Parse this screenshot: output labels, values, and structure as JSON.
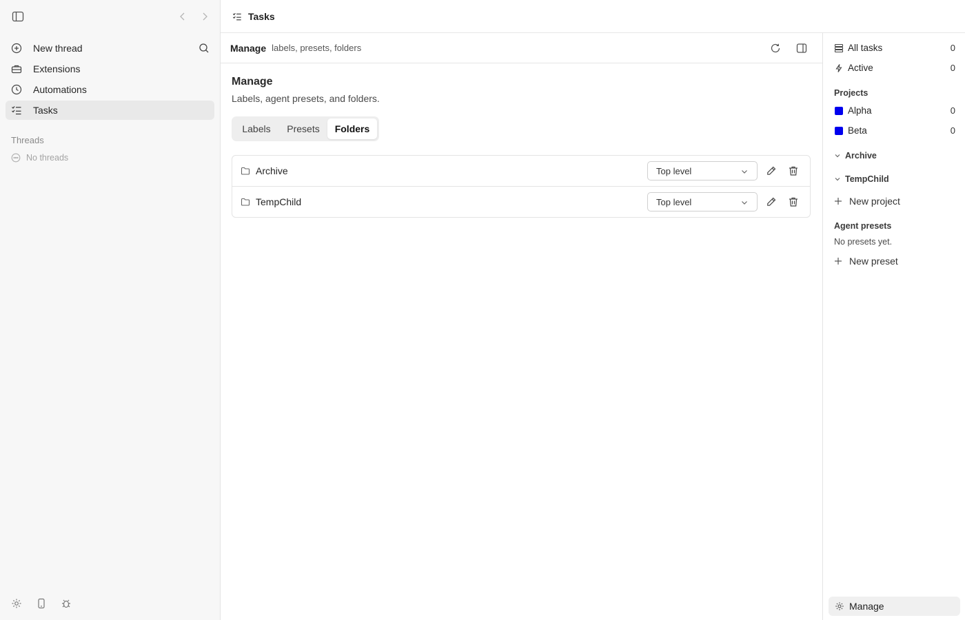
{
  "sidebar": {
    "nav": [
      {
        "label": "New thread",
        "icon": "plus-circle-icon"
      },
      {
        "label": "Extensions",
        "icon": "toolbox-icon"
      },
      {
        "label": "Automations",
        "icon": "clock-icon"
      },
      {
        "label": "Tasks",
        "icon": "checklist-icon",
        "active": true
      }
    ],
    "threads_heading": "Threads",
    "threads_empty": "No threads"
  },
  "header": {
    "title": "Tasks"
  },
  "main": {
    "subheader": {
      "title": "Manage",
      "subtitle": "labels, presets, folders"
    },
    "title": "Manage",
    "subtitle": "Labels, agent presets, and folders.",
    "tabs": [
      {
        "label": "Labels"
      },
      {
        "label": "Presets"
      },
      {
        "label": "Folders",
        "selected": true
      }
    ],
    "folders": [
      {
        "name": "Archive",
        "parent": "Top level"
      },
      {
        "name": "TempChild",
        "parent": "Top level"
      }
    ]
  },
  "rpanel": {
    "all_tasks": {
      "label": "All tasks",
      "count": "0"
    },
    "active": {
      "label": "Active",
      "count": "0"
    },
    "projects_heading": "Projects",
    "projects": [
      {
        "label": "Alpha",
        "count": "0",
        "color": "#0000ee"
      },
      {
        "label": "Beta",
        "count": "0",
        "color": "#0000ee"
      }
    ],
    "folders": [
      {
        "label": "Archive"
      },
      {
        "label": "TempChild"
      }
    ],
    "new_project": "New project",
    "presets_heading": "Agent presets",
    "presets_empty": "No presets yet.",
    "new_preset": "New preset",
    "manage": "Manage"
  },
  "colors": {
    "sidebar_bg": "#f7f7f7",
    "active_item_bg": "#e9e9e9",
    "project_color": "#0000ee",
    "border": "#e3e3e3"
  }
}
